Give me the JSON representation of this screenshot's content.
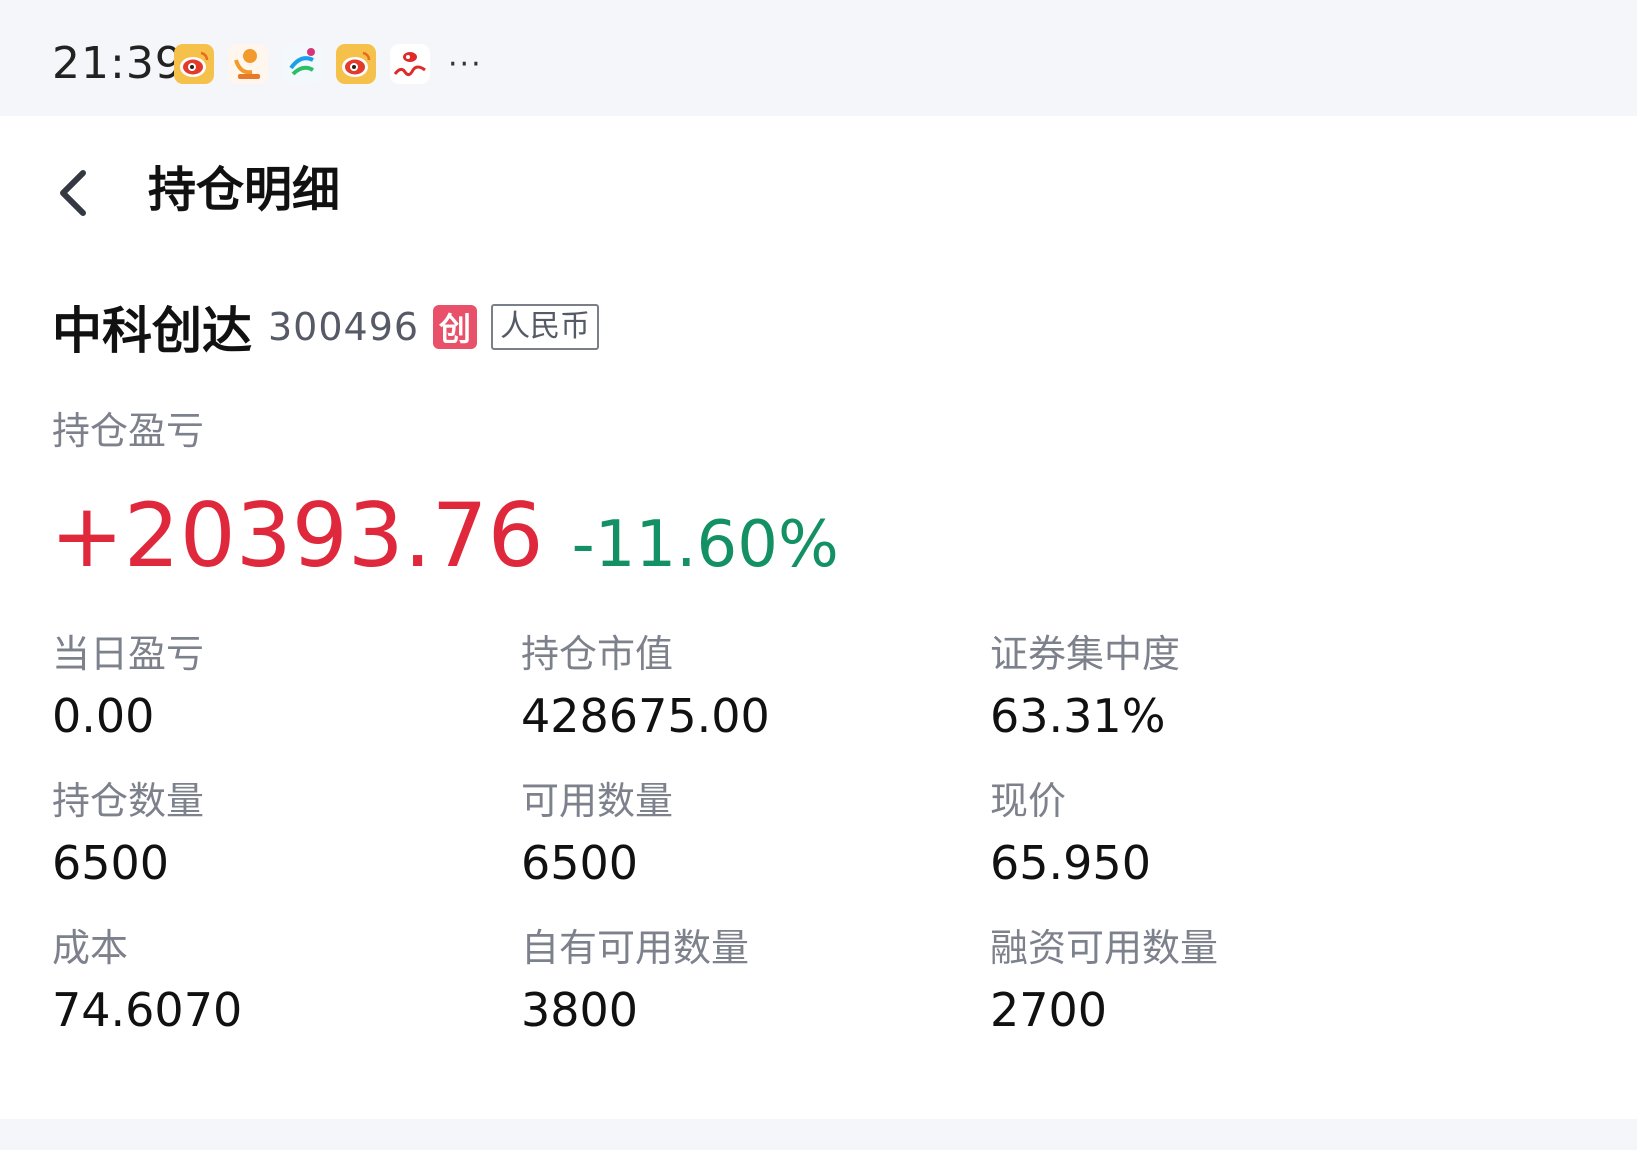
{
  "status_bar": {
    "time": "21:39",
    "notification_icons": [
      {
        "name": "weibo-icon",
        "color": "#f5b942"
      },
      {
        "name": "sinfo-app-icon",
        "color": "#f39a2c"
      },
      {
        "name": "china-mobile-icon",
        "color": "#1aa0e8"
      },
      {
        "name": "weibo-icon",
        "color": "#f5b942"
      },
      {
        "name": "sina-icon",
        "color": "#e02a2a"
      }
    ],
    "more": "···"
  },
  "header": {
    "title": "持仓明细"
  },
  "stock": {
    "name": "中科创达",
    "code": "300496",
    "board_badge": "创",
    "currency": "人民币"
  },
  "pnl": {
    "label": "持仓盈亏",
    "amount": "+20393.76",
    "ratio": "-11.60%"
  },
  "metrics": [
    {
      "label": "当日盈亏",
      "value": "0.00"
    },
    {
      "label": "持仓市值",
      "value": "428675.00"
    },
    {
      "label": "证券集中度",
      "value": "63.31%"
    },
    {
      "label": "持仓数量",
      "value": "6500"
    },
    {
      "label": "可用数量",
      "value": "6500"
    },
    {
      "label": "现价",
      "value": "65.950"
    },
    {
      "label": "成本",
      "value": "74.6070"
    },
    {
      "label": "自有可用数量",
      "value": "3800"
    },
    {
      "label": "融资可用数量",
      "value": "2700"
    }
  ],
  "colors": {
    "gain": "#e0283c",
    "loss": "#139064",
    "badge": "#e9506a"
  }
}
